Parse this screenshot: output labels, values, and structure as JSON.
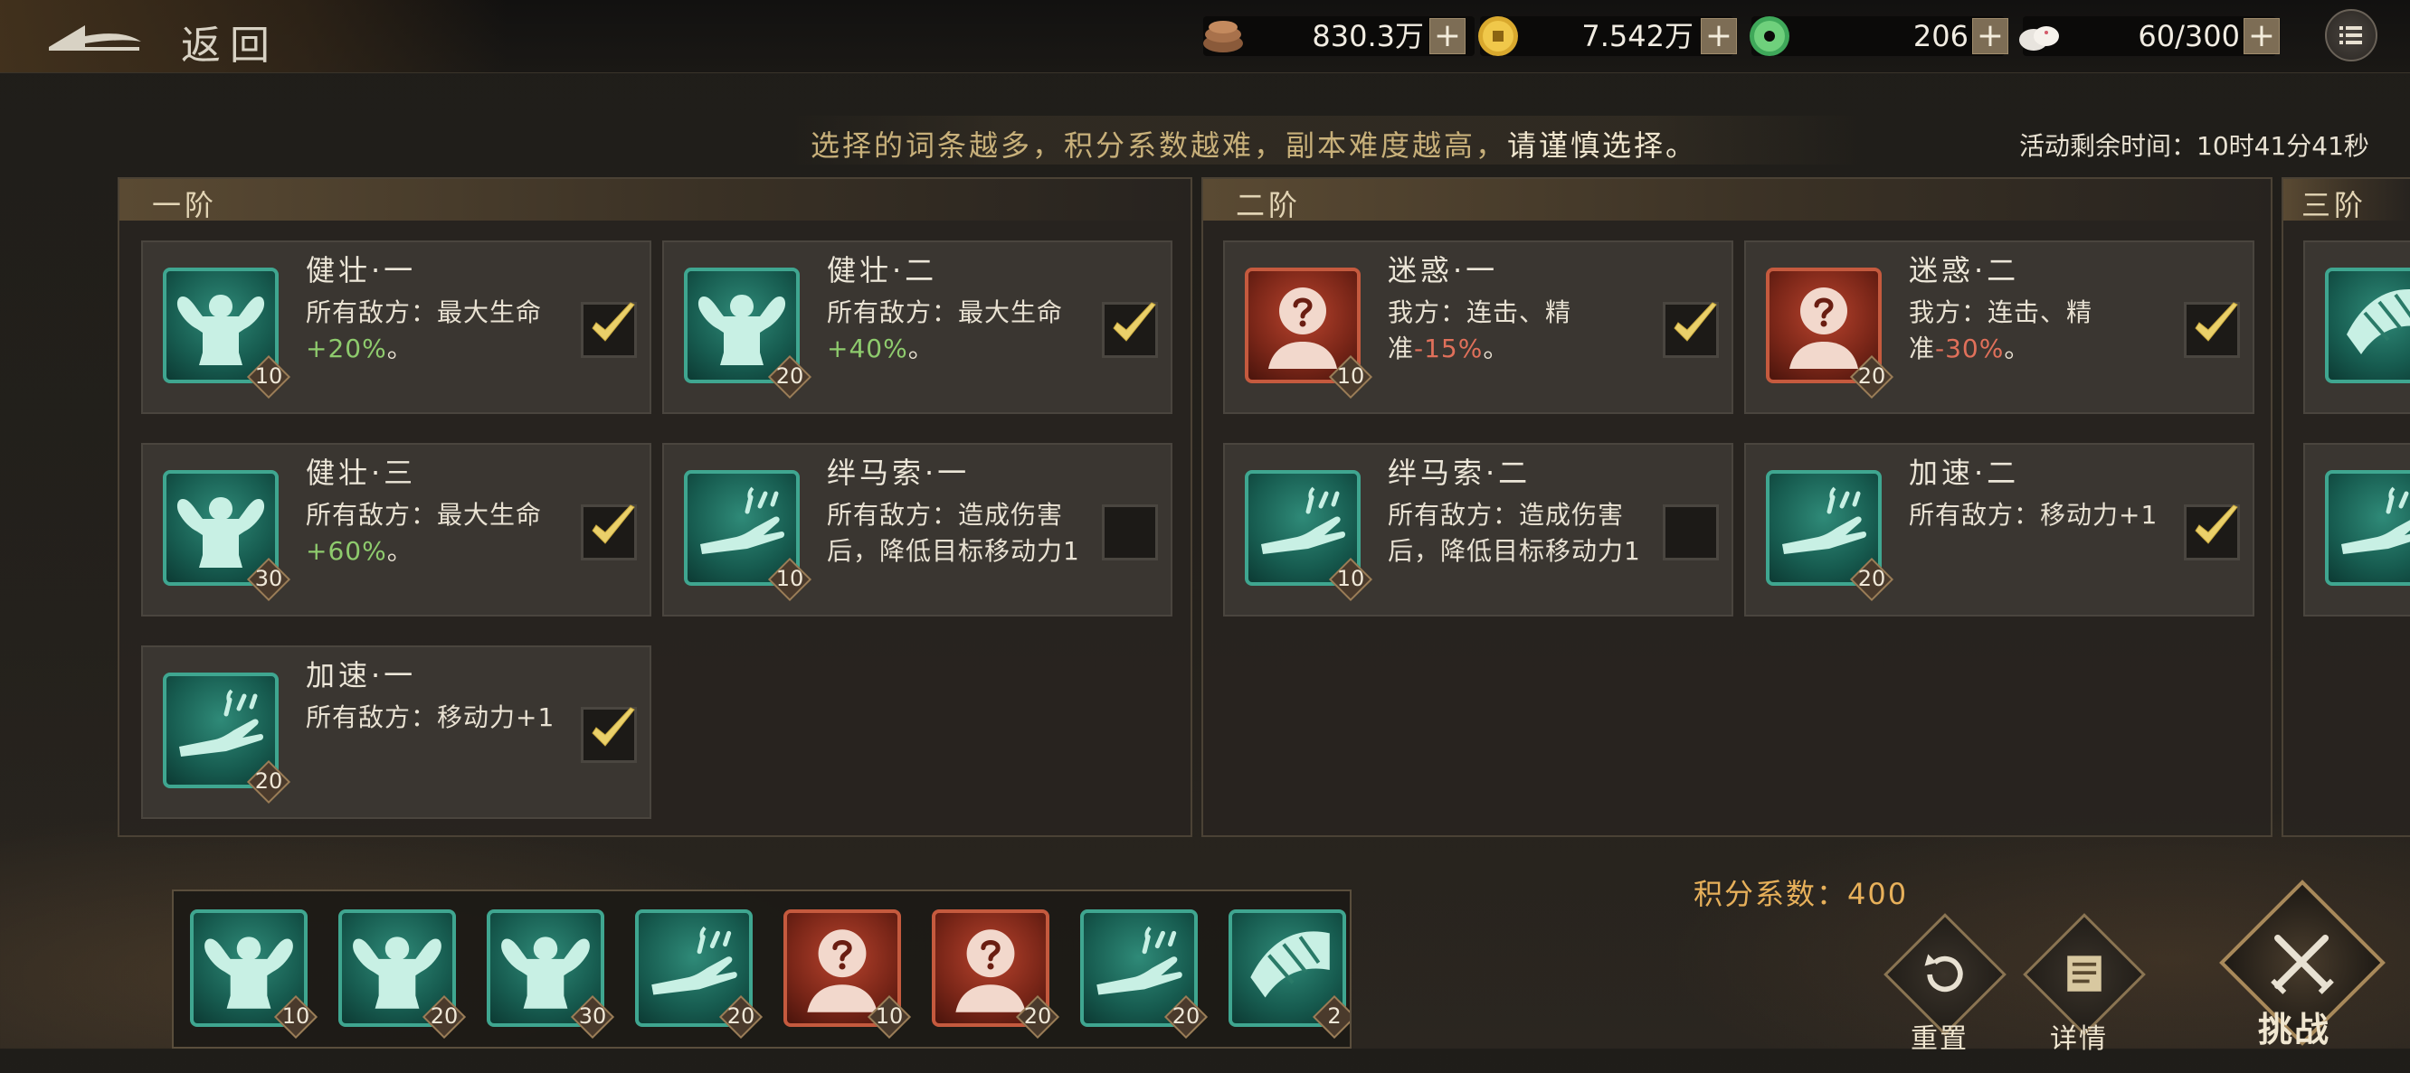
{
  "header": {
    "back_label": "返回"
  },
  "resources": [
    {
      "icon": "copper-ingots-icon",
      "value": "830.3万"
    },
    {
      "icon": "gold-coin-icon",
      "value": "7.542万"
    },
    {
      "icon": "jade-disc-icon",
      "value": "206"
    },
    {
      "icon": "steamed-bun-icon",
      "value": "60/300"
    }
  ],
  "hint": {
    "normal": "选择的词条越多，积分系数越难，副本难度越高，",
    "strong": "请谨慎选择。"
  },
  "timer": "活动剩余时间：10时41分41秒",
  "tiers": [
    {
      "title": "一阶",
      "cards": [
        {
          "icon": "muscle-icon",
          "color": "teal",
          "level": "10",
          "title": "健壮·一",
          "desc_a": "所有敌方：最大生命",
          "desc_hl": "+20%",
          "hl_type": "pos",
          "desc_b": "。",
          "checked": true
        },
        {
          "icon": "muscle-icon",
          "color": "teal",
          "level": "20",
          "title": "健壮·二",
          "desc_a": "所有敌方：最大生命",
          "desc_hl": "+40%",
          "hl_type": "pos",
          "desc_b": "。",
          "checked": true
        },
        {
          "icon": "muscle-icon",
          "color": "teal",
          "level": "30",
          "title": "健壮·三",
          "desc_a": "所有敌方：最大生命",
          "desc_hl": "+60%",
          "hl_type": "pos",
          "desc_b": "。",
          "checked": true
        },
        {
          "icon": "hand-rope-icon",
          "color": "teal",
          "level": "10",
          "title": "绊马索·一",
          "desc_a": "所有敌方：造成伤害后，降低目标移动力1",
          "desc_hl": "",
          "hl_type": "",
          "desc_b": "",
          "checked": false
        },
        {
          "icon": "hand-rope-icon",
          "color": "teal",
          "level": "20",
          "title": "加速·一",
          "desc_a": "所有敌方：移动力+1",
          "desc_hl": "",
          "hl_type": "",
          "desc_b": "",
          "checked": true
        }
      ]
    },
    {
      "title": "二阶",
      "cards": [
        {
          "icon": "confused-head-icon",
          "color": "red",
          "level": "10",
          "title": "迷惑·一",
          "desc_a": "我方：连击、精准",
          "desc_hl": "-15%",
          "hl_type": "neg",
          "desc_b": "。",
          "checked": true
        },
        {
          "icon": "confused-head-icon",
          "color": "red",
          "level": "20",
          "title": "迷惑·二",
          "desc_a": "我方：连击、精准",
          "desc_hl": "-30%",
          "hl_type": "neg",
          "desc_b": "。",
          "checked": true
        },
        {
          "icon": "hand-rope-icon",
          "color": "teal",
          "level": "10",
          "title": "绊马索·二",
          "desc_a": "所有敌方：造成伤害后，降低目标移动力1",
          "desc_hl": "",
          "hl_type": "",
          "desc_b": "",
          "checked": false
        },
        {
          "icon": "hand-rope-icon",
          "color": "teal",
          "level": "20",
          "title": "加速·二",
          "desc_a": "所有敌方：移动力+1",
          "desc_hl": "",
          "hl_type": "",
          "desc_b": "",
          "checked": true
        }
      ]
    },
    {
      "title": "三阶"
    }
  ],
  "selected_slots": [
    {
      "icon": "muscle-icon",
      "color": "teal",
      "level": "10"
    },
    {
      "icon": "muscle-icon",
      "color": "teal",
      "level": "20"
    },
    {
      "icon": "muscle-icon",
      "color": "teal",
      "level": "30"
    },
    {
      "icon": "hand-rope-icon",
      "color": "teal",
      "level": "20"
    },
    {
      "icon": "confused-head-icon",
      "color": "red",
      "level": "10"
    },
    {
      "icon": "confused-head-icon",
      "color": "red",
      "level": "20"
    },
    {
      "icon": "hand-rope-icon",
      "color": "teal",
      "level": "20"
    },
    {
      "icon": "bandaged-arm-icon",
      "color": "teal",
      "level": "2"
    }
  ],
  "score": {
    "label": "积分系数：",
    "value": "400"
  },
  "buttons": {
    "reset": "重置",
    "details": "详情",
    "challenge": "挑战"
  },
  "colors": {
    "positive": "#8ecb6d",
    "negative": "#e0705a",
    "accent": "#e7b05a",
    "teal_icon": "#2f8a78",
    "red_icon": "#b8432d"
  }
}
